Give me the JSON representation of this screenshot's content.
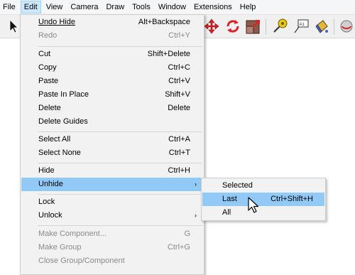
{
  "menubar": {
    "items": [
      "File",
      "Edit",
      "View",
      "Camera",
      "Draw",
      "Tools",
      "Window",
      "Extensions",
      "Help"
    ],
    "active": "Edit"
  },
  "toolbar": {
    "icons": [
      "select-arrow-icon",
      "move-icon",
      "rotate-icon",
      "scale-icon",
      "tape-measure-icon",
      "text-icon",
      "paint-bucket-icon",
      "orbit-icon"
    ],
    "text_tool_label": "A1"
  },
  "edit_menu": {
    "undo": {
      "label": "Undo Hide",
      "shortcut": "Alt+Backspace"
    },
    "redo": {
      "label": "Redo",
      "shortcut": "Ctrl+Y"
    },
    "cut": {
      "label": "Cut",
      "shortcut": "Shift+Delete"
    },
    "copy": {
      "label": "Copy",
      "shortcut": "Ctrl+C"
    },
    "paste": {
      "label": "Paste",
      "shortcut": "Ctrl+V"
    },
    "paste_in_place": {
      "label": "Paste In Place",
      "shortcut": "Shift+V"
    },
    "delete": {
      "label": "Delete",
      "shortcut": "Delete"
    },
    "delete_guides": {
      "label": "Delete Guides"
    },
    "select_all": {
      "label": "Select All",
      "shortcut": "Ctrl+A"
    },
    "select_none": {
      "label": "Select None",
      "shortcut": "Ctrl+T"
    },
    "hide": {
      "label": "Hide",
      "shortcut": "Ctrl+H"
    },
    "unhide": {
      "label": "Unhide",
      "arrow": "›"
    },
    "lock": {
      "label": "Lock"
    },
    "unlock": {
      "label": "Unlock",
      "arrow": "›"
    },
    "make_component": {
      "label": "Make Component...",
      "shortcut": "G"
    },
    "make_group": {
      "label": "Make Group",
      "shortcut": "Ctrl+G"
    },
    "close_group": {
      "label": "Close Group/Component"
    }
  },
  "unhide_submenu": {
    "selected": {
      "label": "Selected"
    },
    "last": {
      "label": "Last",
      "shortcut": "Ctrl+Shift+H"
    },
    "all": {
      "label": "All"
    }
  },
  "colors": {
    "highlight": "#91c9f7",
    "menu_bg": "#f2f2f2",
    "active_menubar": "#cce8ff"
  }
}
